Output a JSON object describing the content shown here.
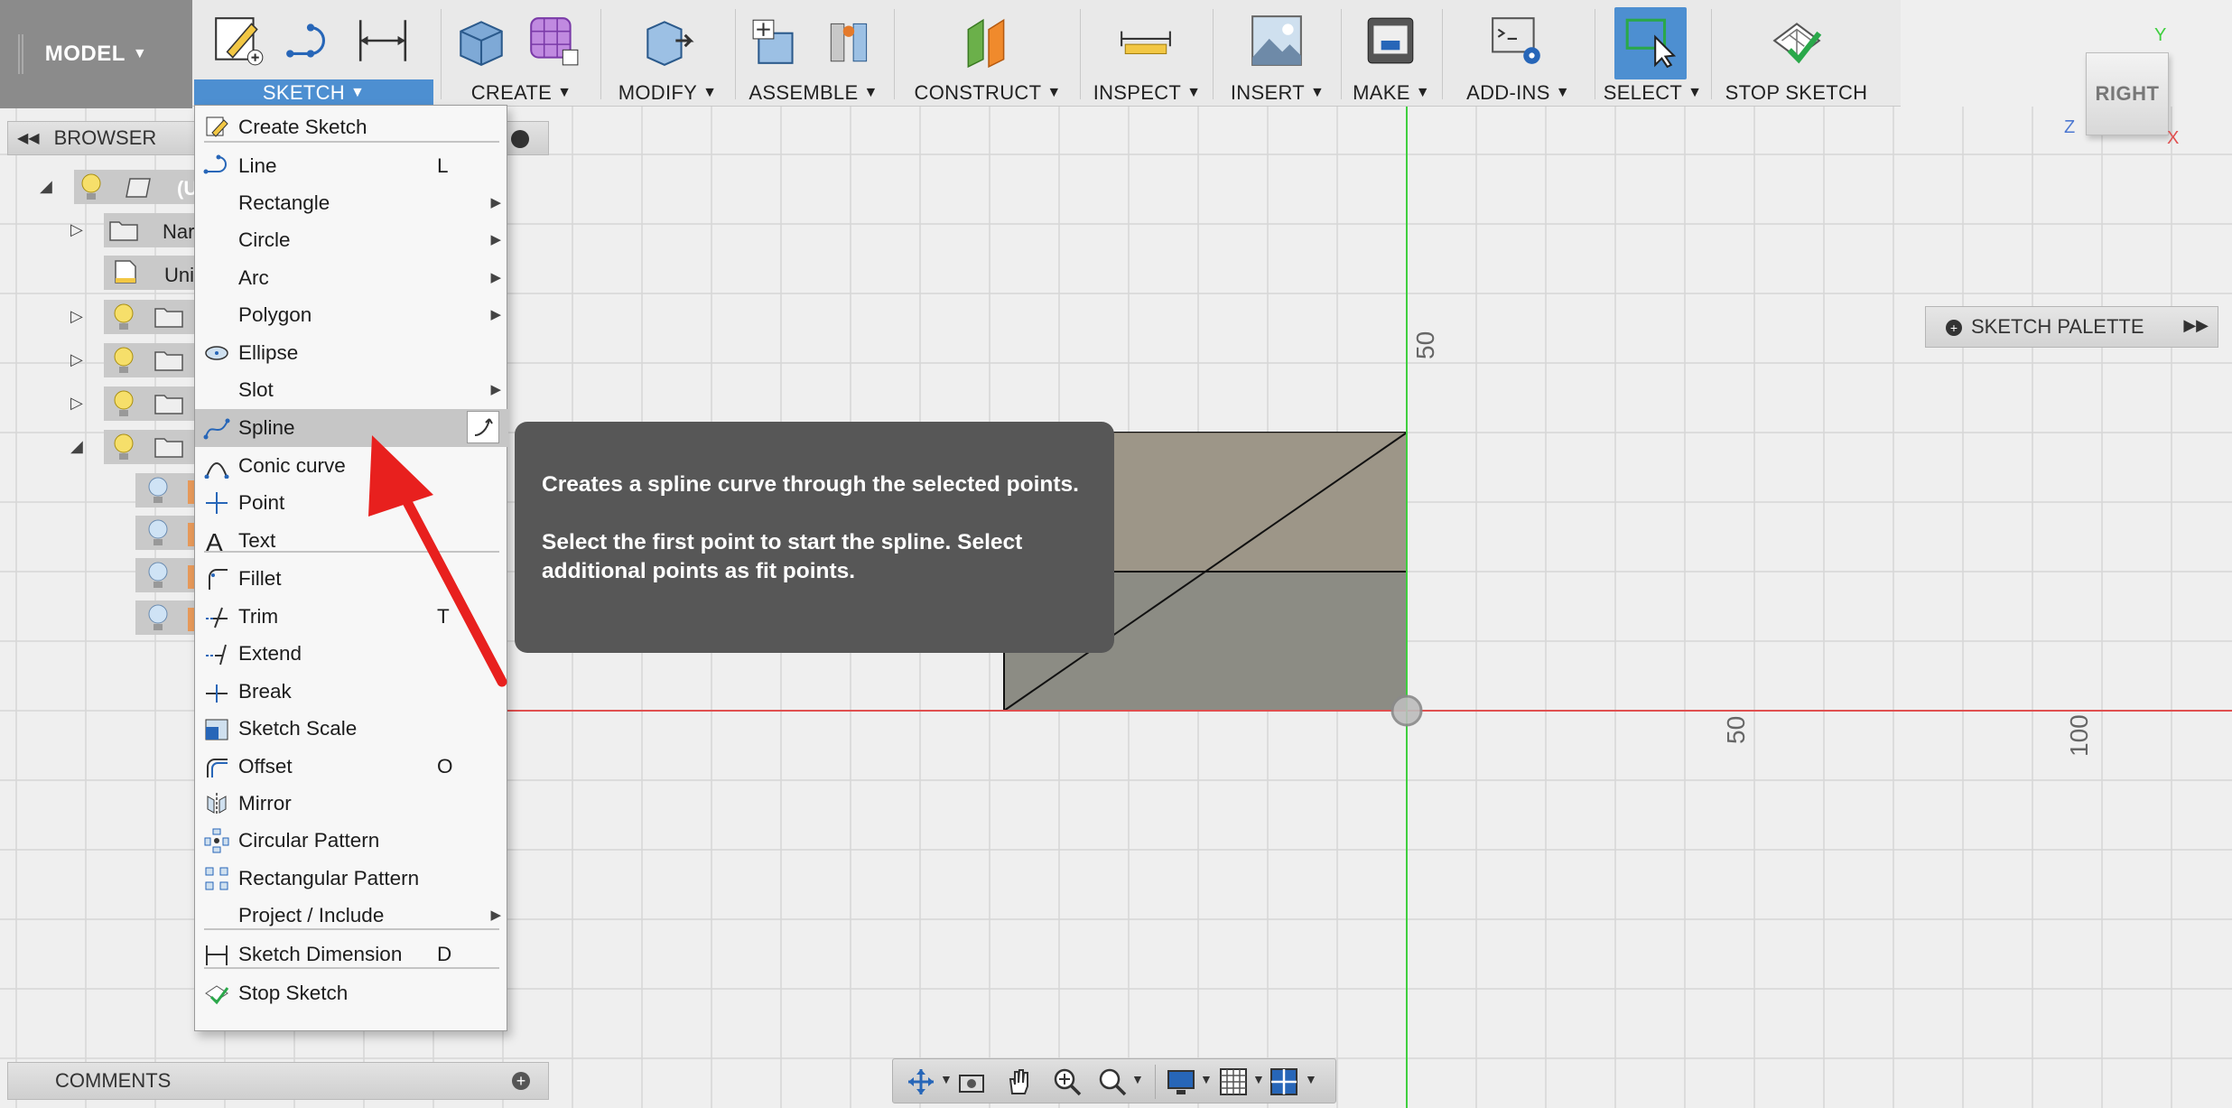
{
  "toolbar": {
    "workspace": "MODEL",
    "groups": [
      {
        "label": "SKETCH",
        "icon": "create-sketch-icon"
      },
      {
        "label": "CREATE",
        "icon": "create-box-icon"
      },
      {
        "label": "MODIFY",
        "icon": "modify-push-pull-icon"
      },
      {
        "label": "ASSEMBLE",
        "icon": "assemble-joint-icon"
      },
      {
        "label": "CONSTRUCT",
        "icon": "construct-plane-icon"
      },
      {
        "label": "INSPECT",
        "icon": "measure-ruler-icon"
      },
      {
        "label": "INSERT",
        "icon": "insert-image-icon"
      },
      {
        "label": "MAKE",
        "icon": "3d-print-icon"
      },
      {
        "label": "ADD-INS",
        "icon": "scripts-addins-icon"
      },
      {
        "label": "SELECT",
        "icon": "select-window-icon"
      },
      {
        "label": "STOP SKETCH",
        "icon": "stop-sketch-icon"
      }
    ]
  },
  "browser": {
    "title": "BROWSER",
    "partial_labels": [
      "(U",
      "Nar",
      "Uni"
    ]
  },
  "comments": {
    "title": "COMMENTS"
  },
  "sketch_menu": {
    "items": [
      {
        "label": "Create Sketch",
        "shortcut": "",
        "submenu": false,
        "icon": "create-sketch-icon"
      },
      {
        "label": "Line",
        "shortcut": "L",
        "submenu": false,
        "icon": "line-icon"
      },
      {
        "label": "Rectangle",
        "shortcut": "",
        "submenu": true,
        "icon": ""
      },
      {
        "label": "Circle",
        "shortcut": "",
        "submenu": true,
        "icon": ""
      },
      {
        "label": "Arc",
        "shortcut": "",
        "submenu": true,
        "icon": ""
      },
      {
        "label": "Polygon",
        "shortcut": "",
        "submenu": true,
        "icon": ""
      },
      {
        "label": "Ellipse",
        "shortcut": "",
        "submenu": false,
        "icon": "ellipse-icon"
      },
      {
        "label": "Slot",
        "shortcut": "",
        "submenu": true,
        "icon": ""
      },
      {
        "label": "Spline",
        "shortcut": "",
        "submenu": false,
        "icon": "spline-icon",
        "highlighted": true
      },
      {
        "label": "Conic curve",
        "shortcut": "",
        "submenu": false,
        "icon": "conic-curve-icon"
      },
      {
        "label": "Point",
        "shortcut": "",
        "submenu": false,
        "icon": "point-icon"
      },
      {
        "label": "Text",
        "shortcut": "",
        "submenu": false,
        "icon": "text-icon"
      },
      {
        "label": "Fillet",
        "shortcut": "",
        "submenu": false,
        "icon": "fillet-icon"
      },
      {
        "label": "Trim",
        "shortcut": "T",
        "submenu": false,
        "icon": "trim-icon"
      },
      {
        "label": "Extend",
        "shortcut": "",
        "submenu": false,
        "icon": "extend-icon"
      },
      {
        "label": "Break",
        "shortcut": "",
        "submenu": false,
        "icon": "break-icon"
      },
      {
        "label": "Sketch Scale",
        "shortcut": "",
        "submenu": false,
        "icon": "sketch-scale-icon"
      },
      {
        "label": "Offset",
        "shortcut": "O",
        "submenu": false,
        "icon": "offset-icon"
      },
      {
        "label": "Mirror",
        "shortcut": "",
        "submenu": false,
        "icon": "mirror-icon"
      },
      {
        "label": "Circular Pattern",
        "shortcut": "",
        "submenu": false,
        "icon": "circular-pattern-icon"
      },
      {
        "label": "Rectangular Pattern",
        "shortcut": "",
        "submenu": false,
        "icon": "rectangular-pattern-icon"
      },
      {
        "label": "Project / Include",
        "shortcut": "",
        "submenu": true,
        "icon": ""
      },
      {
        "label": "Sketch Dimension",
        "shortcut": "D",
        "submenu": false,
        "icon": "sketch-dimension-icon"
      },
      {
        "label": "Stop Sketch",
        "shortcut": "",
        "submenu": false,
        "icon": "stop-sketch-icon"
      }
    ]
  },
  "tooltip": {
    "line1": "Creates a spline curve through the selected points.",
    "line2": "Select the first point to start the spline. Select additional points as fit points."
  },
  "palette": {
    "title": "SKETCH PALETTE"
  },
  "viewcube": {
    "face": "RIGHT",
    "axes": [
      "Y",
      "Z",
      "X"
    ]
  },
  "rulers": {
    "vertical": "50",
    "h1": "50",
    "h2": "100"
  },
  "colors": {
    "accent": "#4d8fd1",
    "x_axis": "#e05050",
    "y_axis": "#3fcf3f",
    "arrow": "#e8201e",
    "tooltip_bg": "#575757"
  }
}
